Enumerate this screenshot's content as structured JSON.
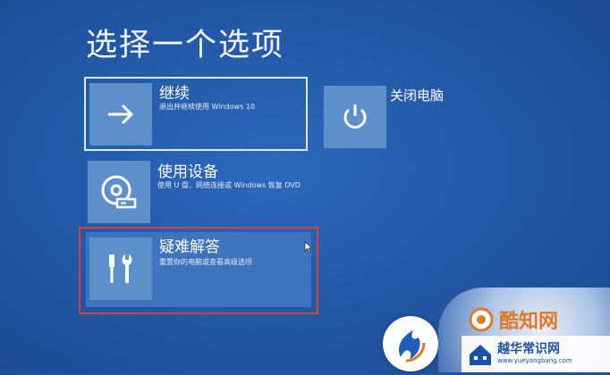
{
  "screen": {
    "title": "选择一个选项"
  },
  "options": [
    {
      "label": "继续",
      "description": "退出并继续使用 Windows 10",
      "icon": "arrow-right-icon"
    },
    {
      "label": "使用设备",
      "description": "使用 U 盘、网络连接或 Windows 恢复 DVD",
      "icon": "disc-drive-icon"
    },
    {
      "label": "疑难解答",
      "description": "重置你的电脑或查看高级选项",
      "icon": "tools-icon"
    }
  ],
  "shutdown": {
    "label": "关闭电脑",
    "icon": "power-icon"
  },
  "colors": {
    "background": "#245aa8",
    "tile": "#5d8fcb",
    "selected_border": "#d34141"
  },
  "watermark": {
    "brand": "酷知网",
    "site_title": "越华常识网",
    "site_url": "www.yueyangbang.com"
  }
}
